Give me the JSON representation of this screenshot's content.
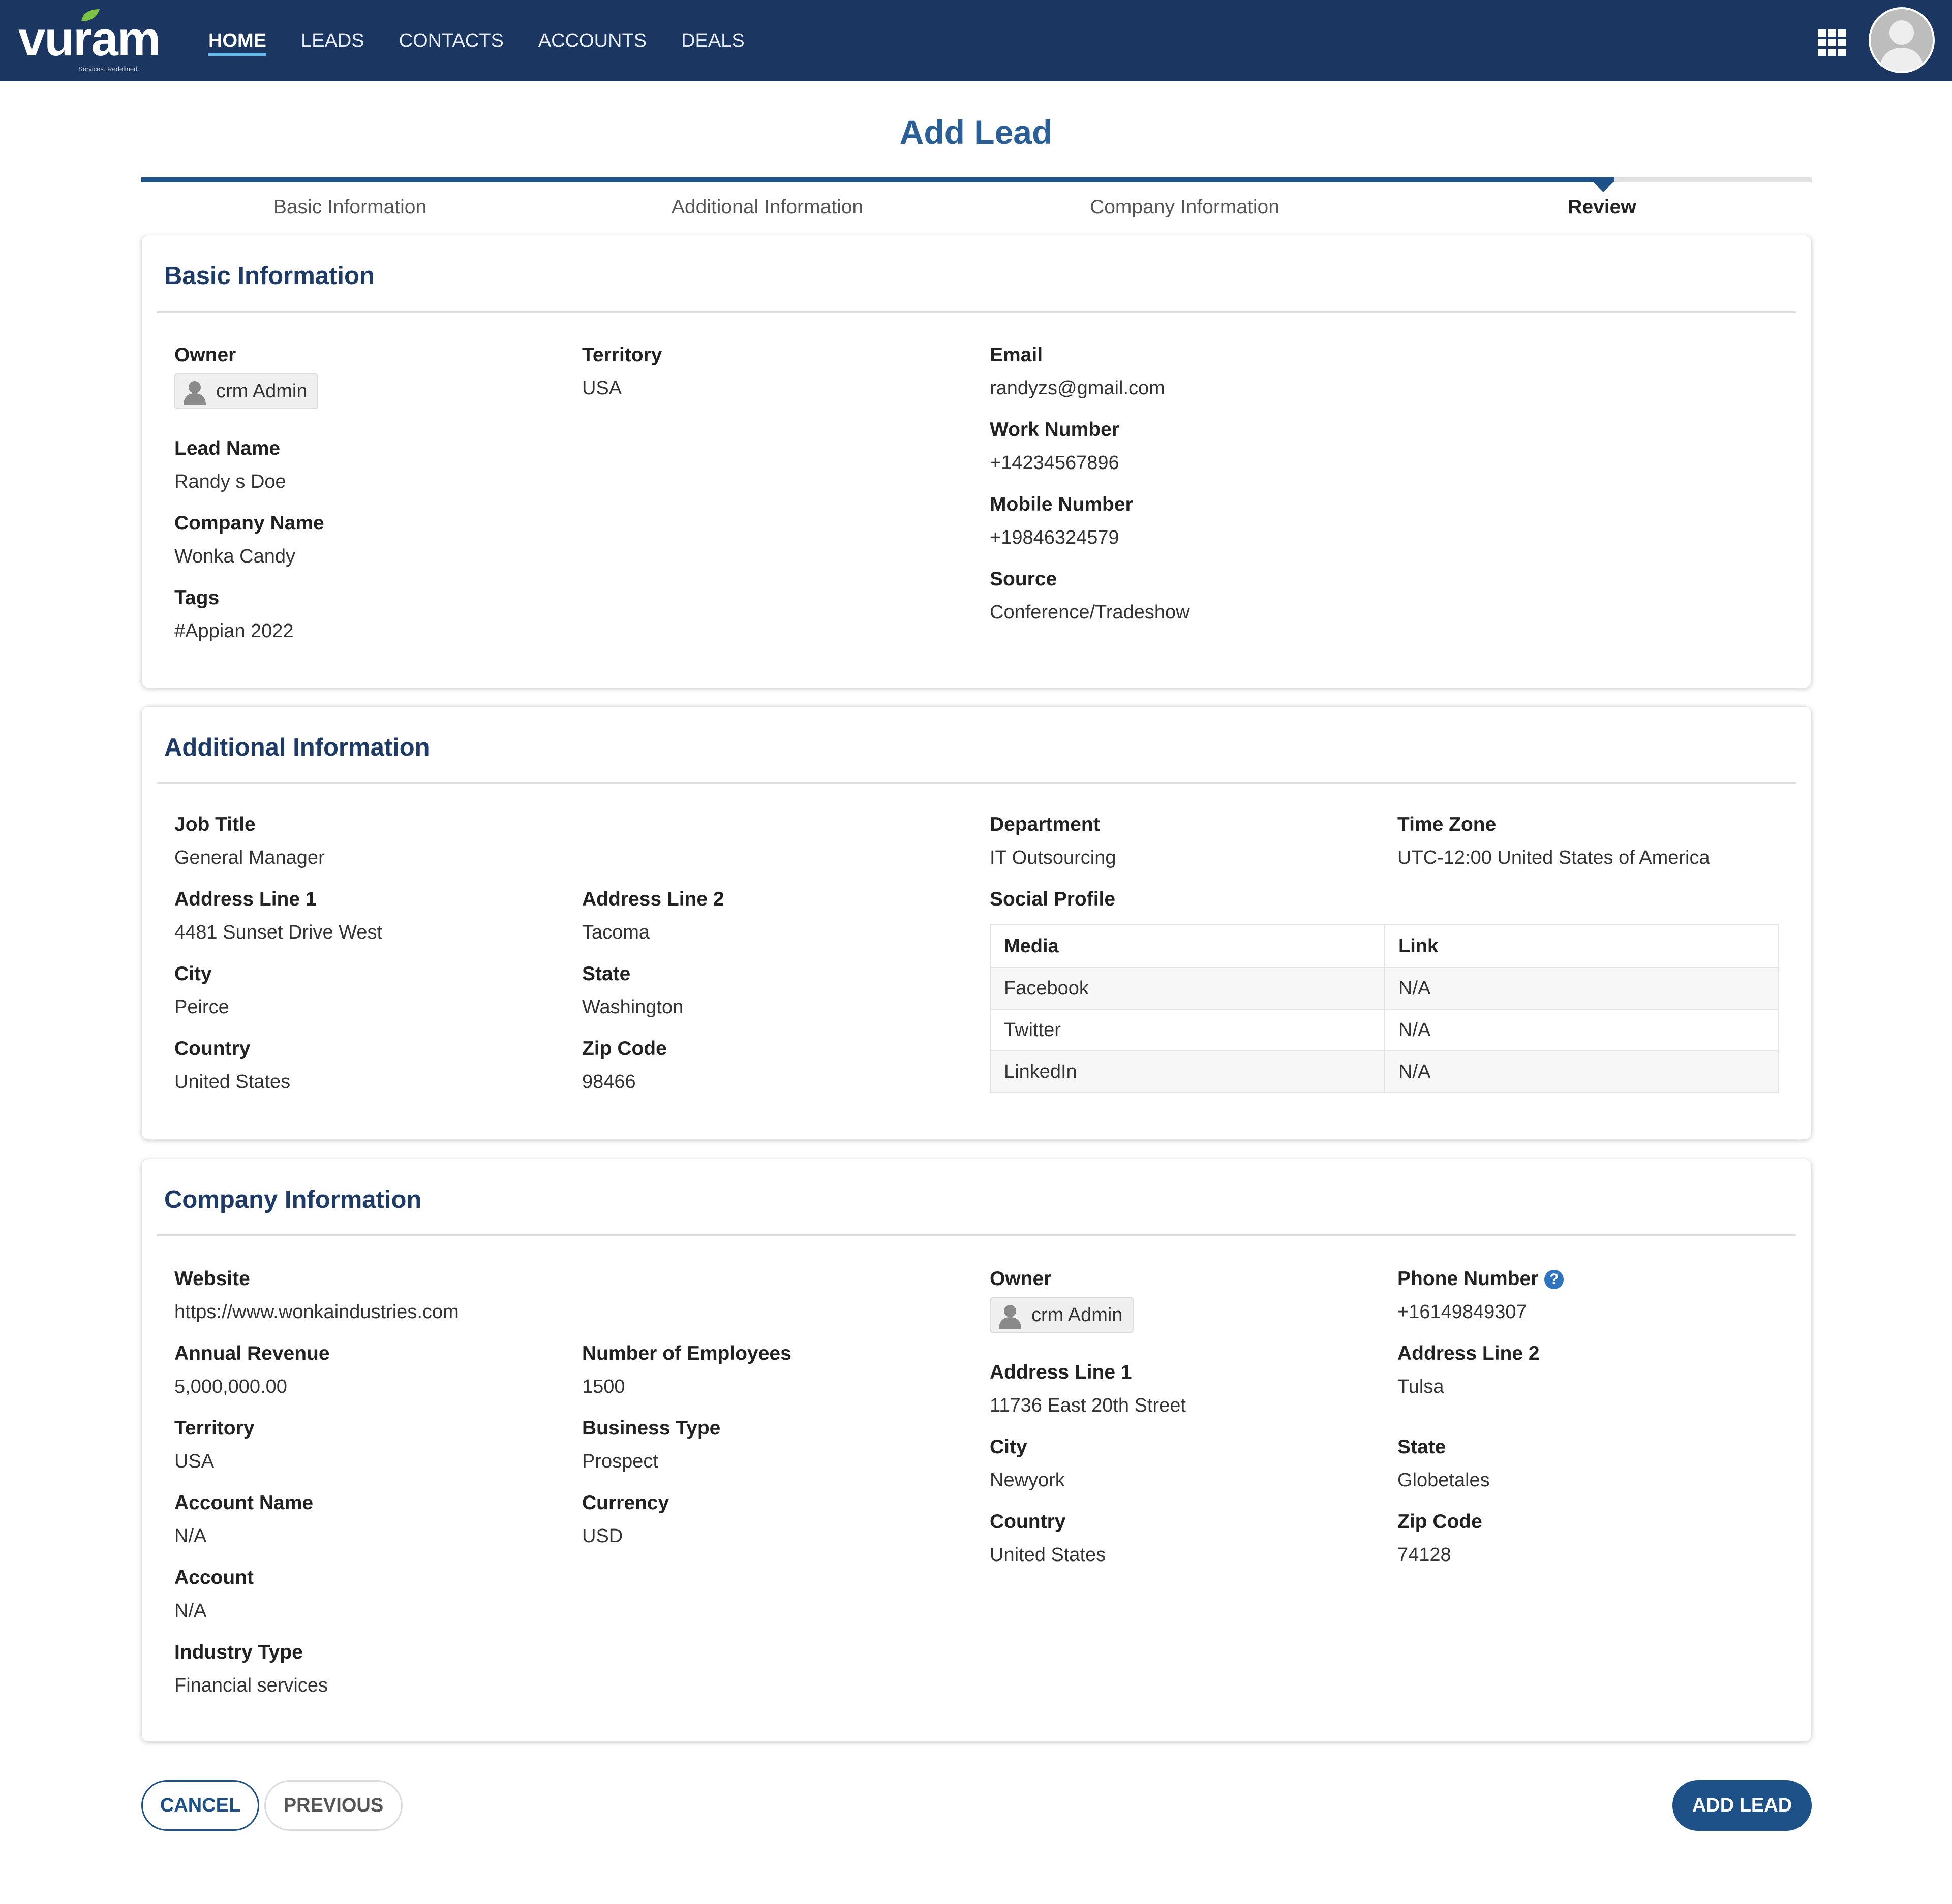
{
  "nav": {
    "logo_text": "vuram",
    "logo_tagline": "Services. Redefined.",
    "items": [
      {
        "label": "HOME",
        "active": true
      },
      {
        "label": "LEADS",
        "active": false
      },
      {
        "label": "CONTACTS",
        "active": false
      },
      {
        "label": "ACCOUNTS",
        "active": false
      },
      {
        "label": "DEALS",
        "active": false
      }
    ]
  },
  "page": {
    "title": "Add Lead",
    "steps": [
      "Basic Information",
      "Additional Information",
      "Company Information",
      "Review"
    ],
    "current_step": "Review"
  },
  "basic": {
    "title": "Basic Information",
    "owner_label": "Owner",
    "owner_value": "crm Admin",
    "lead_name_label": "Lead Name",
    "lead_name_value": "Randy s Doe",
    "company_name_label": "Company Name",
    "company_name_value": "Wonka Candy",
    "tags_label": "Tags",
    "tags_value": "#Appian 2022",
    "territory_label": "Territory",
    "territory_value": "USA",
    "email_label": "Email",
    "email_value": "randyzs@gmail.com",
    "work_label": "Work Number",
    "work_value": "+14234567896",
    "mobile_label": "Mobile Number",
    "mobile_value": "+19846324579",
    "source_label": "Source",
    "source_value": "Conference/Tradeshow"
  },
  "additional": {
    "title": "Additional Information",
    "job_title_label": "Job Title",
    "job_title_value": "General Manager",
    "addr1_label": "Address Line 1",
    "addr1_value": "4481 Sunset Drive West",
    "addr2_label": "Address Line 2",
    "addr2_value": "Tacoma",
    "city_label": "City",
    "city_value": "Peirce",
    "state_label": "State",
    "state_value": "Washington",
    "country_label": "Country",
    "country_value": "United States",
    "zip_label": "Zip Code",
    "zip_value": "98466",
    "department_label": "Department",
    "department_value": "IT Outsourcing",
    "timezone_label": "Time Zone",
    "timezone_value": "UTC-12:00 United States of America",
    "social_label": "Social Profile",
    "social_headers": [
      "Media",
      "Link"
    ],
    "social_rows": [
      {
        "media": "Facebook",
        "link": "N/A"
      },
      {
        "media": "Twitter",
        "link": "N/A"
      },
      {
        "media": "LinkedIn",
        "link": "N/A"
      }
    ]
  },
  "company": {
    "title": "Company Information",
    "website_label": "Website",
    "website_value": "https://www.wonkaindustries.com",
    "revenue_label": "Annual Revenue",
    "revenue_value": "5,000,000.00",
    "employees_label": "Number of Employees",
    "employees_value": "1500",
    "territory_label": "Territory",
    "territory_value": "USA",
    "business_type_label": "Business Type",
    "business_type_value": "Prospect",
    "account_name_label": "Account Name",
    "account_name_value": "N/A",
    "currency_label": "Currency",
    "currency_value": "USD",
    "account_label": "Account",
    "account_value": "N/A",
    "industry_label": "Industry Type",
    "industry_value": "Financial services",
    "owner_label": "Owner",
    "owner_value": "crm Admin",
    "phone_label": "Phone Number",
    "phone_value": "+16149849307",
    "addr1_label": "Address Line 1",
    "addr1_value": "11736 East 20th Street",
    "addr2_label": "Address Line 2",
    "addr2_value": "Tulsa",
    "city_label": "City",
    "city_value": "Newyork",
    "state_label": "State",
    "state_value": "Globetales",
    "country_label": "Country",
    "country_value": "United States",
    "zip_label": "Zip Code",
    "zip_value": "74128"
  },
  "actions": {
    "cancel_label": "CANCEL",
    "previous_label": "PREVIOUS",
    "add_label": "ADD LEAD"
  },
  "colors": {
    "topbar": "#1b3660",
    "accent": "#1f5189",
    "title": "#2a6097",
    "section_title": "#1e3a66"
  }
}
